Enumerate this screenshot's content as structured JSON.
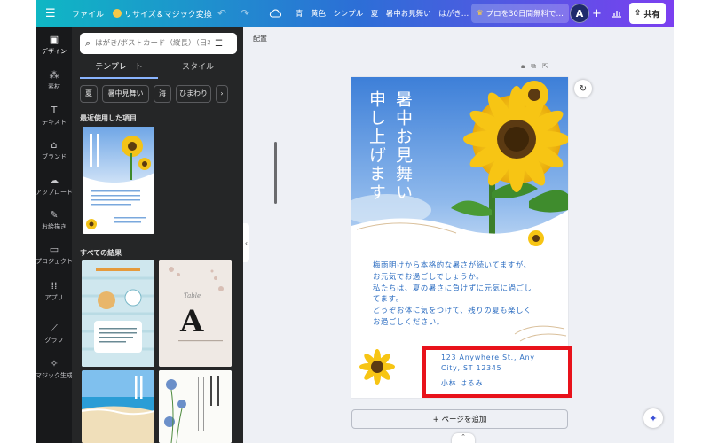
{
  "topbar": {
    "menu_icon": "hamburger-icon",
    "file_label": "ファイル",
    "resize_label": "リサイズ＆マジック変換",
    "doc_title": "青　黄色　シンプル　夏　暑中お見舞い　はがき…",
    "pro_label": "プロを30日間無料で…",
    "avatar_letter": "A",
    "share_label": "共有",
    "accent": "#2c6fd6"
  },
  "rail": {
    "items": [
      {
        "label": "デザイン",
        "icon": "design-icon"
      },
      {
        "label": "素材",
        "icon": "elements-icon"
      },
      {
        "label": "テキスト",
        "icon": "text-icon"
      },
      {
        "label": "ブランド",
        "icon": "brand-icon"
      },
      {
        "label": "アップロード",
        "icon": "upload-icon"
      },
      {
        "label": "お絵描き",
        "icon": "draw-icon"
      },
      {
        "label": "プロジェクト",
        "icon": "folder-icon"
      },
      {
        "label": "アプリ",
        "icon": "apps-icon"
      },
      {
        "label": "グラフ",
        "icon": "chart-icon"
      },
      {
        "label": "マジック生成",
        "icon": "magic-icon"
      }
    ]
  },
  "panel": {
    "search_placeholder": "はがき/ポストカード（縦長）（日本）",
    "tabs": [
      "テンプレート",
      "スタイル"
    ],
    "chips": [
      "夏",
      "暑中見舞い",
      "海",
      "ひまわり",
      "›"
    ],
    "recent_label": "最近使用した項目",
    "results_label": "すべての結果",
    "thumb_a_letter": "A",
    "thumb_a_script": "Table"
  },
  "canvas": {
    "page_label": "配置",
    "add_page_label": "+ ページを追加",
    "card": {
      "title_lines": [
        "暑中お見舞い",
        "申し上げます"
      ],
      "body_lines": [
        "梅雨明けから本格的な暑さが続いてますが、",
        "お元気でお過ごしでしょうか。",
        "私たちは、夏の暑さに負けずに元気に過ごし",
        "てます。",
        "どうぞお体に気をつけて、残りの夏も楽しく",
        "お過ごしください。"
      ],
      "address_lines": [
        "123 Anywhere St., Any",
        "City, ST 12345"
      ],
      "name": "小林 はるみ",
      "text_color": "#2f6fc2"
    },
    "highlight_color": "#e8121b"
  }
}
